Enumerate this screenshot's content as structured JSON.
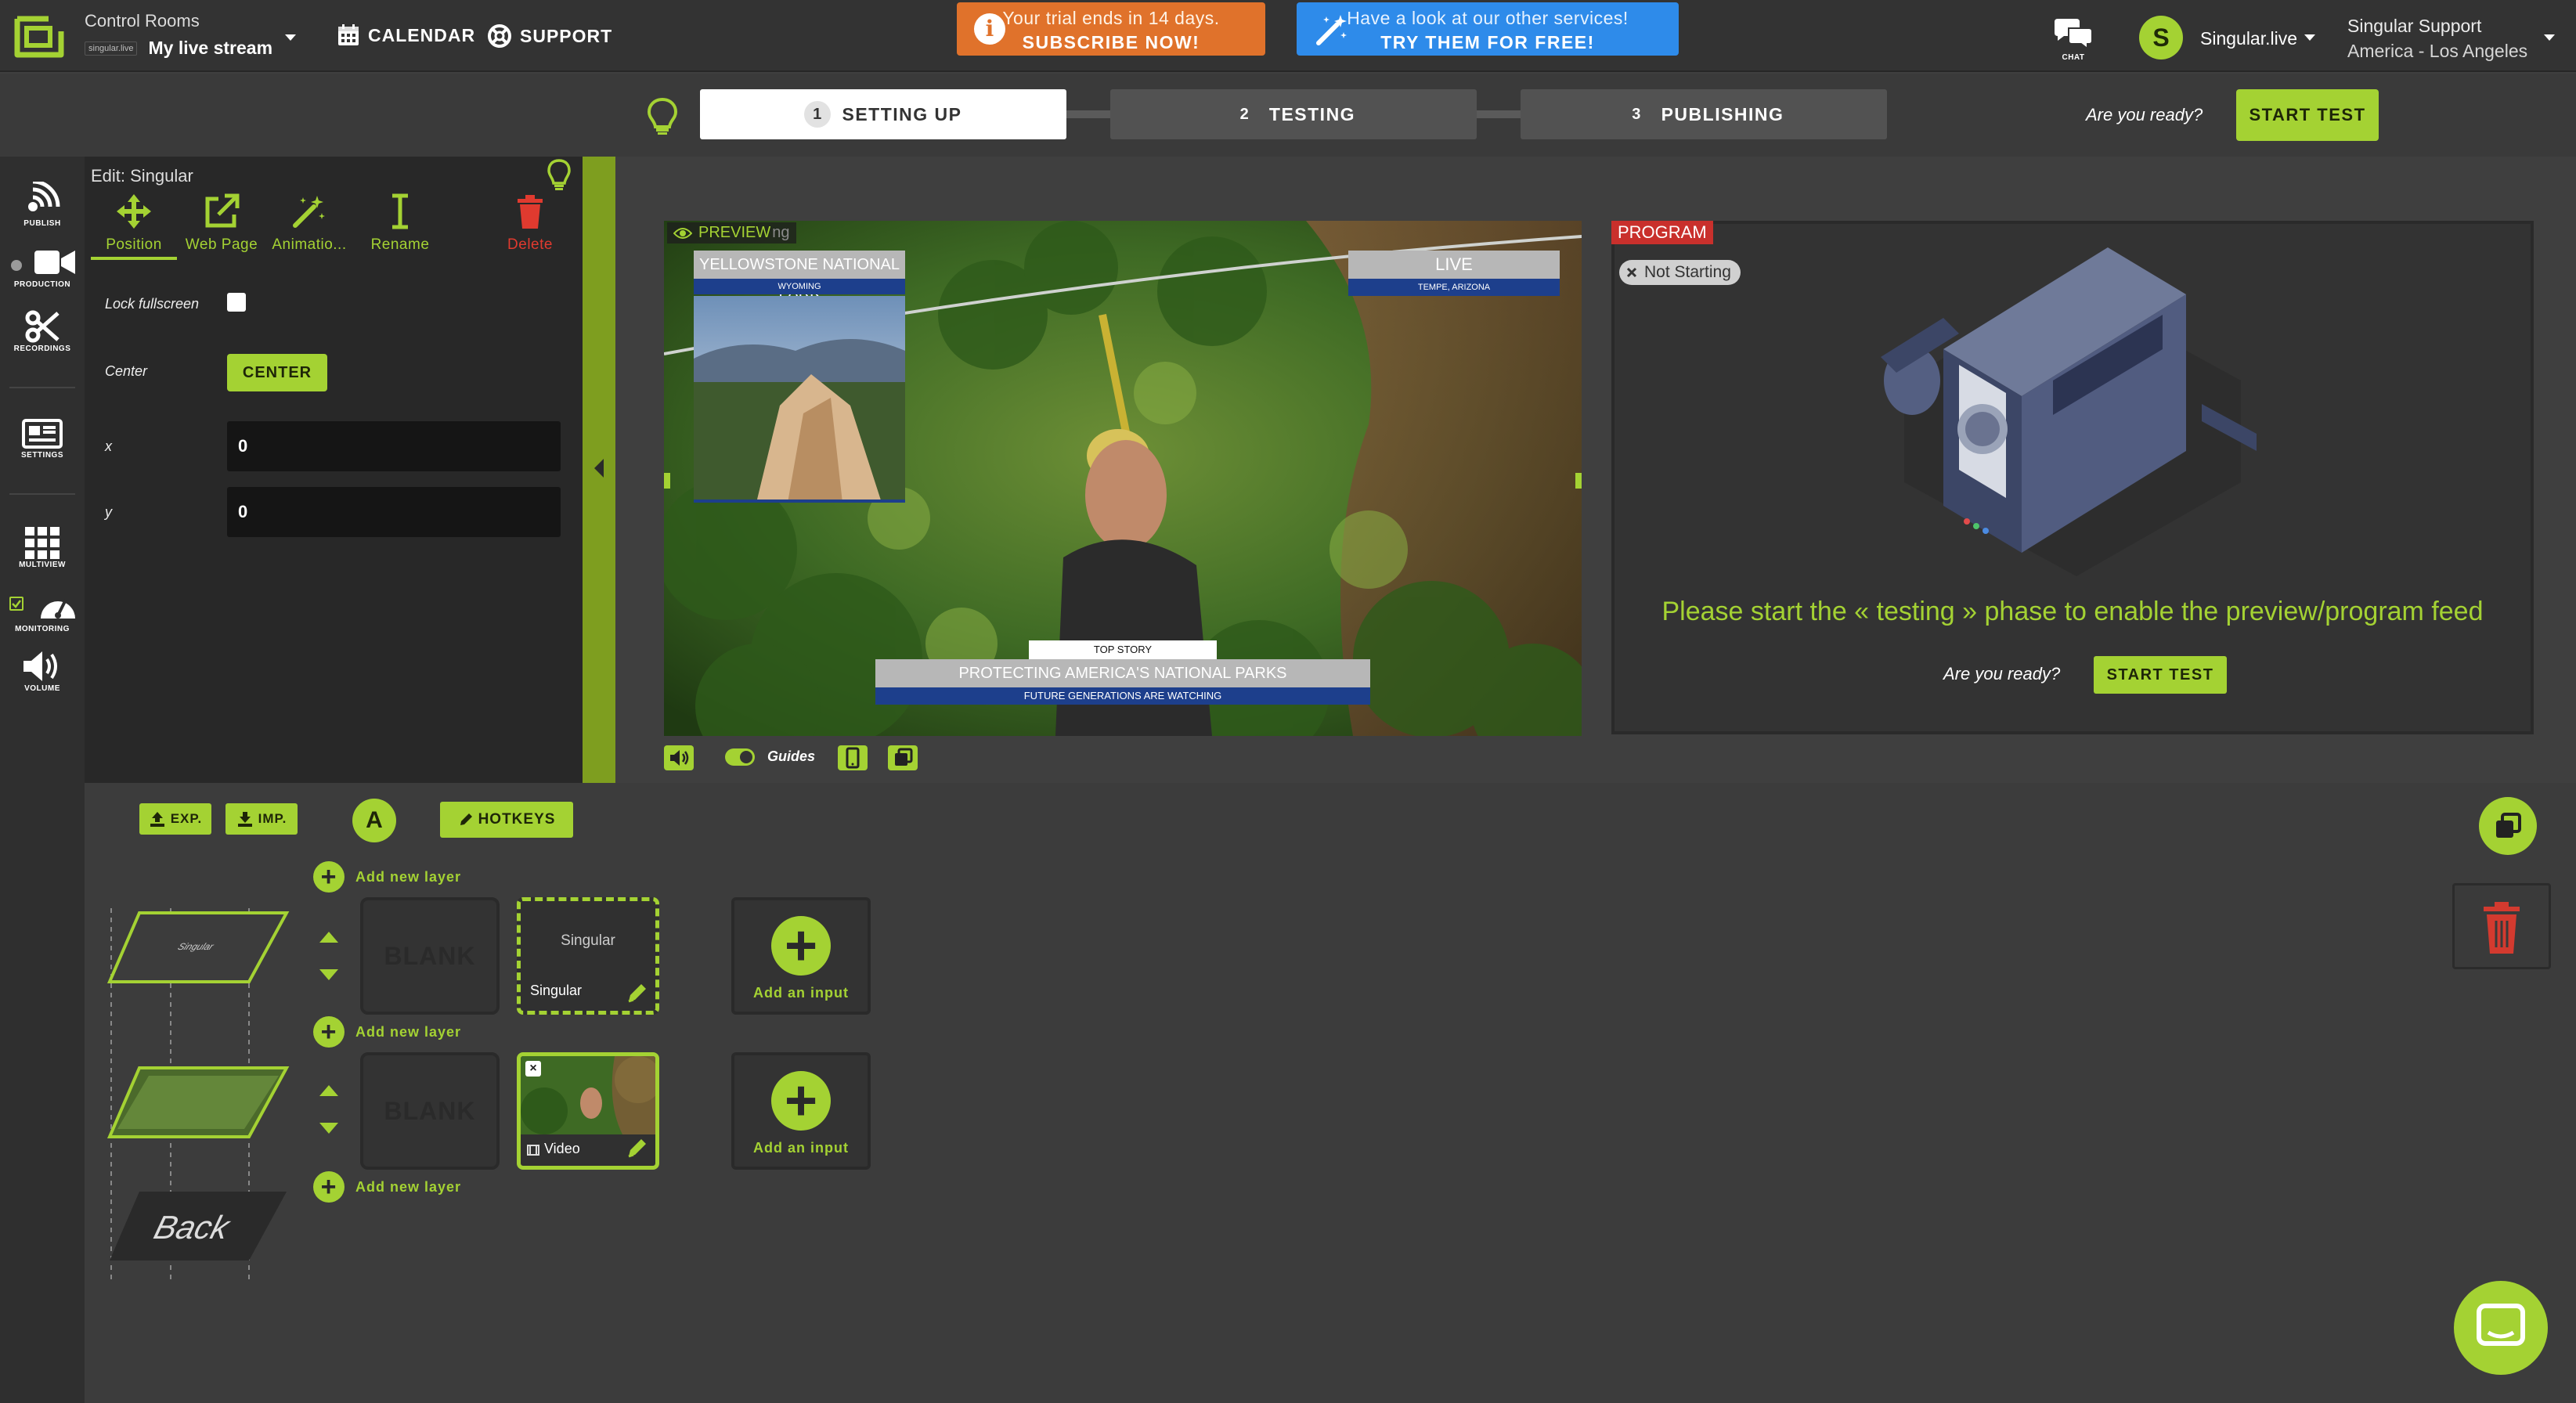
{
  "topbar": {
    "control_rooms_label": "Control Rooms",
    "stream_org": "singular.live",
    "stream_name": "My live stream",
    "nav": [
      {
        "label": "CALENDAR",
        "icon": "calendar-icon"
      },
      {
        "label": "SUPPORT",
        "icon": "lifebuoy-icon"
      }
    ],
    "trial": {
      "line1": "Your trial ends in 14 days.",
      "line2": "SUBSCRIBE NOW!",
      "icon": "info-icon"
    },
    "promo": {
      "line1": "Have a look at our other services!",
      "line2": "TRY THEM FOR FREE!",
      "icon": "magic-wand-icon"
    },
    "chat_label": "CHAT",
    "user": {
      "initial": "S",
      "name": "Singular.live"
    },
    "org": {
      "name": "Singular Support",
      "region": "America - Los Angeles"
    }
  },
  "steps": {
    "items": [
      {
        "num": "1",
        "label": "SETTING UP",
        "active": true
      },
      {
        "num": "2",
        "label": "TESTING",
        "active": false
      },
      {
        "num": "3",
        "label": "PUBLISHING",
        "active": false
      }
    ],
    "ready_text": "Are you ready?",
    "start_label": "START TEST"
  },
  "sidebar": {
    "items": [
      {
        "label": "PUBLISH",
        "icon": "broadcast-icon"
      },
      {
        "label": "PRODUCTION",
        "icon": "video-camera-icon"
      },
      {
        "label": "RECORDINGS",
        "icon": "scissors-icon"
      },
      {
        "label": "SETTINGS",
        "icon": "settings-panel-icon"
      },
      {
        "label": "MULTIVIEW",
        "icon": "grid-icon"
      },
      {
        "label": "MONITORING",
        "icon": "gauge-icon"
      },
      {
        "label": "VOLUME",
        "icon": "speaker-icon"
      }
    ]
  },
  "edit": {
    "title": "Edit: Singular",
    "tools": [
      {
        "label": "Position",
        "icon": "move-icon"
      },
      {
        "label": "Web Page",
        "icon": "external-link-icon"
      },
      {
        "label": "Animatio...",
        "icon": "magic-wand-icon"
      },
      {
        "label": "Rename",
        "icon": "text-cursor-icon"
      },
      {
        "label": "Delete",
        "icon": "trash-icon"
      }
    ],
    "lock_label": "Lock fullscreen",
    "center_label": "Center",
    "center_button": "CENTER",
    "x_label": "x",
    "x_value": "0",
    "y_label": "y",
    "y_value": "0"
  },
  "preview": {
    "label": "PREVIEW",
    "overlay_ghost": "ng",
    "gfx": {
      "top_left_title": "YELLOWSTONE NATIONAL PARK",
      "top_left_sub": "WYOMING",
      "top_right_title": "LIVE",
      "top_right_sub": "TEMPE, ARIZONA",
      "lower_tag": "TOP STORY",
      "lower_title": "PROTECTING AMERICA'S NATIONAL PARKS",
      "lower_sub": "FUTURE GENERATIONS ARE WATCHING"
    },
    "guides_label": "Guides"
  },
  "program": {
    "label": "PROGRAM",
    "status": "Not Starting",
    "message": "Please start the « testing » phase to enable the preview/program feed",
    "ready_text": "Are you ready?",
    "start_label": "START TEST"
  },
  "bottom": {
    "export_label": "EXP.",
    "import_label": "IMP.",
    "a_label": "A",
    "hotkeys_label": "HOTKEYS",
    "add_layer_label": "Add new layer",
    "blank_label": "BLANK",
    "add_input_label": "Add an input",
    "singular_card": {
      "title": "Singular",
      "caption": "Singular"
    },
    "video_card": {
      "caption": "Video"
    },
    "stack_top_label": "Singular",
    "back_label": "Back"
  },
  "colors": {
    "accent": "#a4d233",
    "trial": "#e0722b",
    "promo": "#2e8bea",
    "program": "#c9302c",
    "delete": "#e03a2f"
  }
}
